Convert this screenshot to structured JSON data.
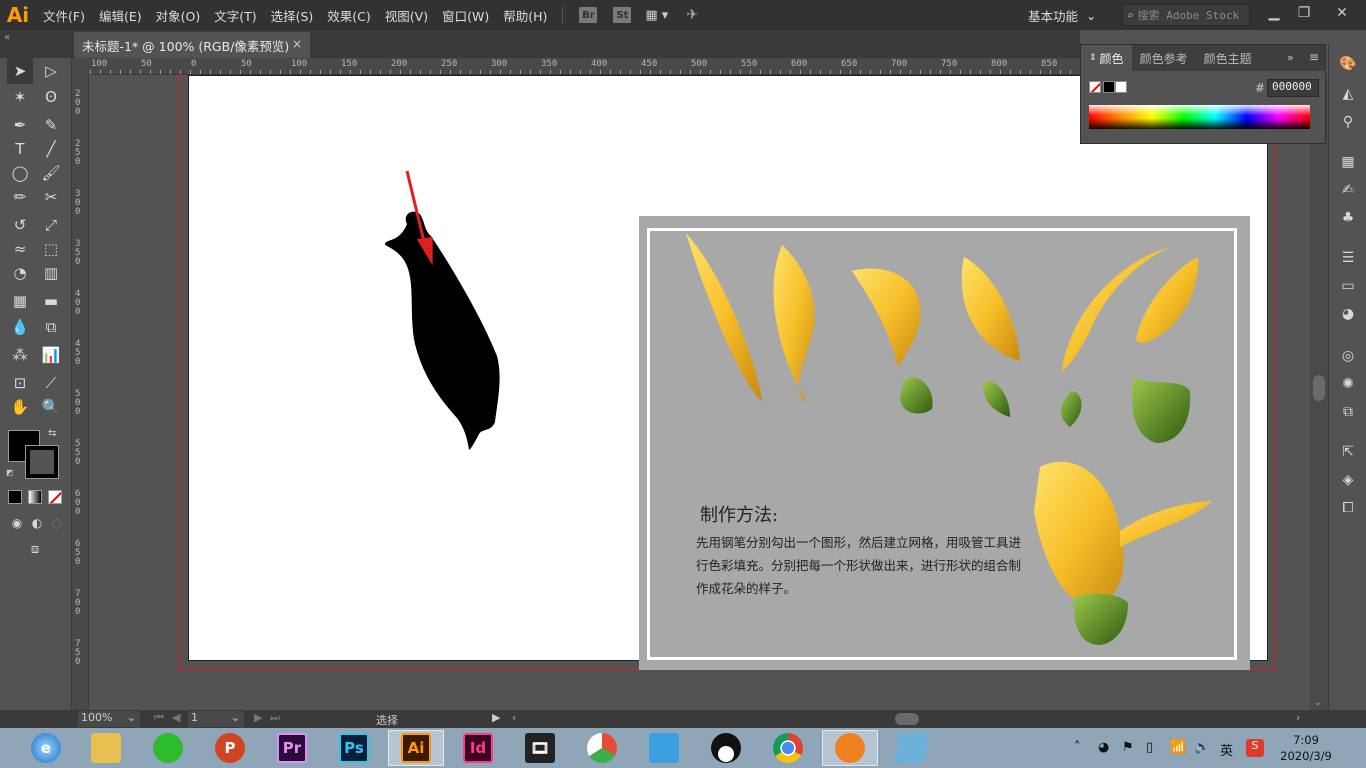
{
  "app": {
    "logo": "Ai",
    "menus": [
      "文件(F)",
      "编辑(E)",
      "对象(O)",
      "文字(T)",
      "选择(S)",
      "效果(C)",
      "视图(V)",
      "窗口(W)",
      "帮助(H)"
    ],
    "bridge_label": "Br",
    "stock_label": "St",
    "workspace": "基本功能",
    "search_placeholder": "搜索 Adobe Stock"
  },
  "document": {
    "tab_title": "未标题-1* @ 100% (RGB/像素预览)",
    "close_glyph": "×"
  },
  "rulers": {
    "top_labels": [
      "100",
      "50",
      "0",
      "50",
      "100",
      "150",
      "200",
      "250",
      "300",
      "350",
      "400",
      "450",
      "500",
      "550",
      "600",
      "650",
      "700",
      "750",
      "800",
      "850"
    ],
    "left_labels": [
      "200",
      "250",
      "300",
      "350",
      "400",
      "450",
      "500",
      "550",
      "600",
      "650",
      "700",
      "750"
    ]
  },
  "artwork": {
    "arrow_color": "#e02020",
    "shape_color": "#000000",
    "method_title": "制作方法:",
    "method_body": "先用钢笔分别勾出一个图形，然后建立网格，用吸管工具进行色彩填充。分别把每一个形状做出来，进行形状的组合制作成花朵的样子。"
  },
  "color_panel": {
    "tabs": [
      "颜色",
      "颜色参考",
      "颜色主题"
    ],
    "hex_label": "#",
    "hex_value": "000000"
  },
  "status": {
    "zoom": "100%",
    "page": "1",
    "tool": "选择"
  },
  "taskbar": {
    "apps": [
      {
        "name": "browser",
        "label": "e",
        "color": "#2b7fd3"
      },
      {
        "name": "explorer",
        "label": "",
        "color": "#e8c050"
      },
      {
        "name": "wechat",
        "label": "",
        "color": "#2dbd2d"
      },
      {
        "name": "powerpoint",
        "label": "P",
        "color": "#d04423"
      },
      {
        "name": "premiere",
        "label": "Pr",
        "color": "#2a0a3a"
      },
      {
        "name": "photoshop",
        "label": "Ps",
        "color": "#061e3a"
      },
      {
        "name": "illustrator",
        "label": "Ai",
        "color": "#3a1a00"
      },
      {
        "name": "indesign",
        "label": "Id",
        "color": "#3a0520"
      },
      {
        "name": "video",
        "label": "",
        "color": "#222222"
      },
      {
        "name": "app-ball",
        "label": "",
        "color": "#e84a3a"
      },
      {
        "name": "app-chat",
        "label": "",
        "color": "#3aa0e0"
      },
      {
        "name": "qq",
        "label": "",
        "color": "#111111"
      },
      {
        "name": "chrome",
        "label": "",
        "color": "#dd4433"
      },
      {
        "name": "app-fox",
        "label": "",
        "color": "#f08020"
      },
      {
        "name": "app-book",
        "label": "",
        "color": "#6ab0d8"
      }
    ],
    "ime": "英",
    "time": "7:09",
    "date": "2020/3/9"
  }
}
